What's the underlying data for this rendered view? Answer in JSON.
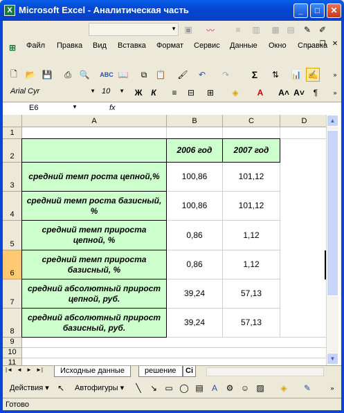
{
  "window": {
    "title": "Microsoft Excel - Аналитическая часть",
    "app_icon": "X"
  },
  "menu": [
    "Файл",
    "Правка",
    "Вид",
    "Вставка",
    "Формат",
    "Сервис",
    "Данные",
    "Окно",
    "Справка"
  ],
  "format_bar": {
    "font": "Arial Cyr",
    "size": "10"
  },
  "name_box": "E6",
  "formula_symbol": "fx",
  "columns": [
    "A",
    "B",
    "C",
    "D"
  ],
  "rows": [
    "1",
    "2",
    "3",
    "4",
    "5",
    "6",
    "7",
    "8",
    "9",
    "10",
    "11"
  ],
  "selected": {
    "column": "E",
    "row": "6"
  },
  "table": {
    "headers": [
      "",
      "2006 год",
      "2007 год"
    ],
    "rows": [
      {
        "label": "средний темп роста цепной,%",
        "v2006": "100,86",
        "v2007": "101,12"
      },
      {
        "label": "средний темп роста базисный, %",
        "v2006": "100,86",
        "v2007": "101,12"
      },
      {
        "label": "средний темп прироста цепной, %",
        "v2006": "0,86",
        "v2007": "1,12"
      },
      {
        "label": "средний темп прироста базисный, %",
        "v2006": "0,86",
        "v2007": "1,12"
      },
      {
        "label": "средний абсолютный прирост цепной, руб.",
        "v2006": "39,24",
        "v2007": "57,13"
      },
      {
        "label": "средний абсолютный прирост базисный, руб.",
        "v2006": "39,24",
        "v2007": "57,13"
      }
    ]
  },
  "sheet_tabs": [
    "Исходные данные",
    "решение",
    "Сі"
  ],
  "drawing": {
    "actions": "Действия",
    "autoshapes": "Автофигуры"
  },
  "status": "Готово",
  "colors": {
    "green_fill": "#CCFFCC",
    "title_blue": "#0A5FE8",
    "selected_header": "#FFC874"
  }
}
